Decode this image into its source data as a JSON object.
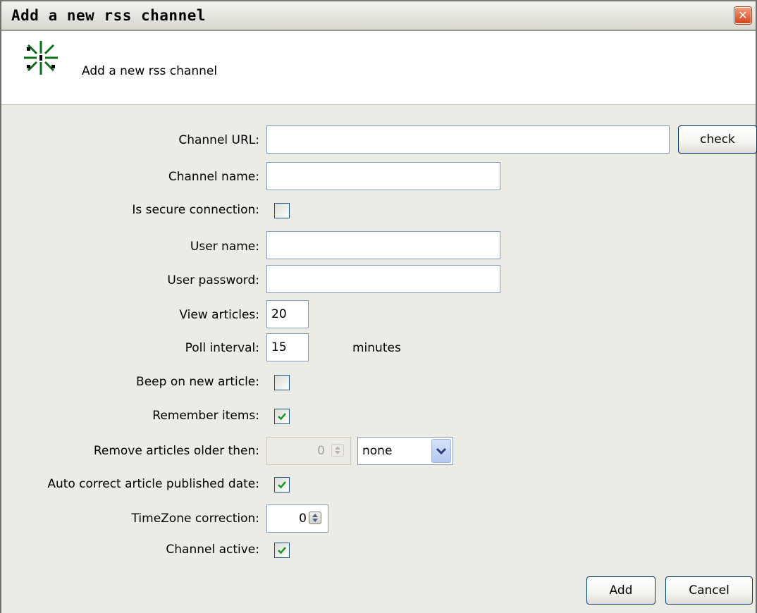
{
  "window": {
    "title": "Add a new rss channel",
    "close_symbol": "✕"
  },
  "header": {
    "text": "Add a new rss channel",
    "icon": "rss-burst-icon"
  },
  "form": {
    "channel_url": {
      "label": "Channel URL:",
      "value": ""
    },
    "check_button": "check",
    "channel_name": {
      "label": "Channel name:",
      "value": ""
    },
    "secure_connection": {
      "label": "Is secure connection:",
      "checked": false
    },
    "user_name": {
      "label": "User name:",
      "value": ""
    },
    "user_password": {
      "label": "User password:",
      "value": ""
    },
    "view_articles": {
      "label": "View articles:",
      "value": "20"
    },
    "poll_interval": {
      "label": "Poll interval:",
      "value": "15",
      "unit": "minutes"
    },
    "beep_new_article": {
      "label": "Beep on new article:",
      "checked": false
    },
    "remember_items": {
      "label": "Remember items:",
      "checked": true
    },
    "remove_older": {
      "label": "Remove articles older then:",
      "value": "0",
      "unit_selected": "none"
    },
    "auto_correct_date": {
      "label": "Auto correct article published date:",
      "checked": true
    },
    "timezone_correction": {
      "label": "TimeZone correction:",
      "value": "0"
    },
    "channel_active": {
      "label": "Channel active:",
      "checked": true
    }
  },
  "buttons": {
    "add": "Add",
    "cancel": "Cancel"
  },
  "colors": {
    "check_green": "#1d9a2a",
    "accent_border": "#7f9db9"
  }
}
